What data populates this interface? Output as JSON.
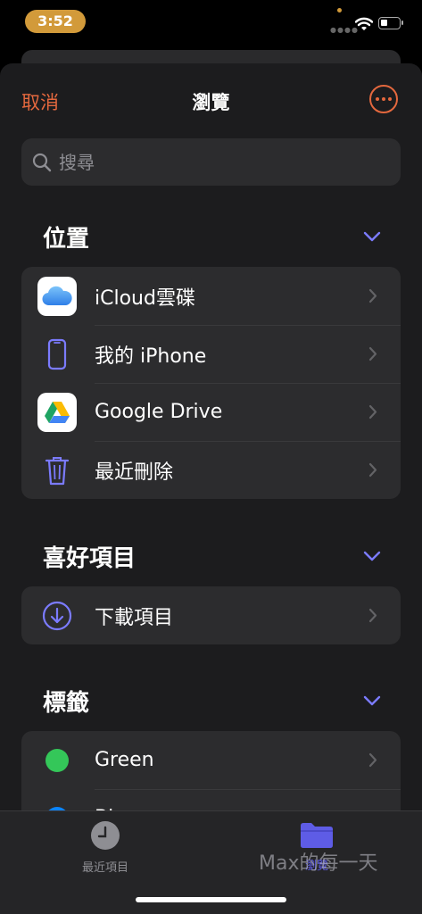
{
  "status": {
    "time": "3:52",
    "accent": "#d29a3a"
  },
  "nav": {
    "cancel": "取消",
    "title": "瀏覽",
    "more_icon": "ellipsis-circle-icon",
    "accent": "#e4683e"
  },
  "search": {
    "placeholder": "搜尋"
  },
  "sections": {
    "locations": {
      "title": "位置",
      "items": [
        {
          "label": "iCloud雲碟",
          "icon": "icloud-icon"
        },
        {
          "label": "我的 iPhone",
          "icon": "iphone-icon"
        },
        {
          "label": "Google Drive",
          "icon": "google-drive-icon"
        },
        {
          "label": "最近刪除",
          "icon": "trash-icon"
        }
      ]
    },
    "favorites": {
      "title": "喜好項目",
      "items": [
        {
          "label": "下載項目",
          "icon": "download-icon"
        }
      ]
    },
    "tags": {
      "title": "標籤",
      "items": [
        {
          "label": "Green",
          "color": "#34c759"
        },
        {
          "label": "Bl",
          "color": "#0a84ff"
        }
      ]
    }
  },
  "tabbar": {
    "recents": {
      "label": "最近項目",
      "icon": "clock-icon"
    },
    "browse": {
      "label": "瀏覽",
      "icon": "folder-icon",
      "active_color": "#5e5ce6"
    },
    "watermark": "Max的每一天"
  }
}
